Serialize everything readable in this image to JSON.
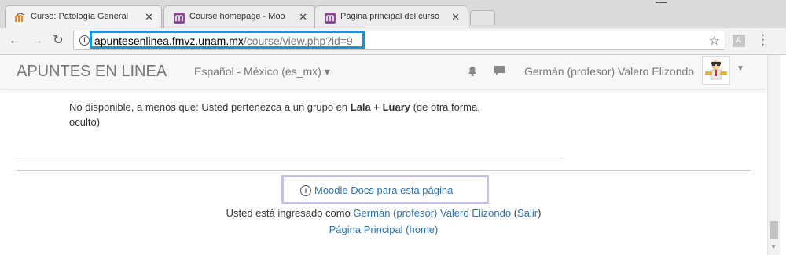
{
  "browser": {
    "tabs": [
      {
        "title": "Curso: Patología General",
        "active": true
      },
      {
        "title": "Course homepage - Moo",
        "active": false
      },
      {
        "title": "Página principal del curso",
        "active": false
      }
    ],
    "close_glyph": "✕",
    "url_host": "apuntesenlinea.fmvz.unam.mx",
    "url_path": "/course/view.php?id=9"
  },
  "navbar": {
    "brand": "APUNTES EN LINEA",
    "language": "Español - México (es_mx) ▾",
    "user_name": "Germán (profesor) Valero Elizondo",
    "caret": "▼"
  },
  "content": {
    "restriction_prefix": "No disponible, a menos que: Usted pertenezca a un grupo en ",
    "restriction_group": "Lala + Luary",
    "restriction_suffix": " (de otra forma, oculto)"
  },
  "footer": {
    "docs_link": "Moodle Docs para esta página",
    "logged_in_prefix": "Usted está ingresado como ",
    "logged_in_user": "Germán (profesor) Valero Elizondo",
    "logout": "Salir",
    "home_link": "Página Principal (home)"
  },
  "colors": {
    "url_highlight": "#1296e0",
    "docs_highlight": "#c6bfe2",
    "link": "#2a73ad",
    "moodle_orange": "#f98012",
    "moodle_tab_icon": "#8a4d8f"
  }
}
